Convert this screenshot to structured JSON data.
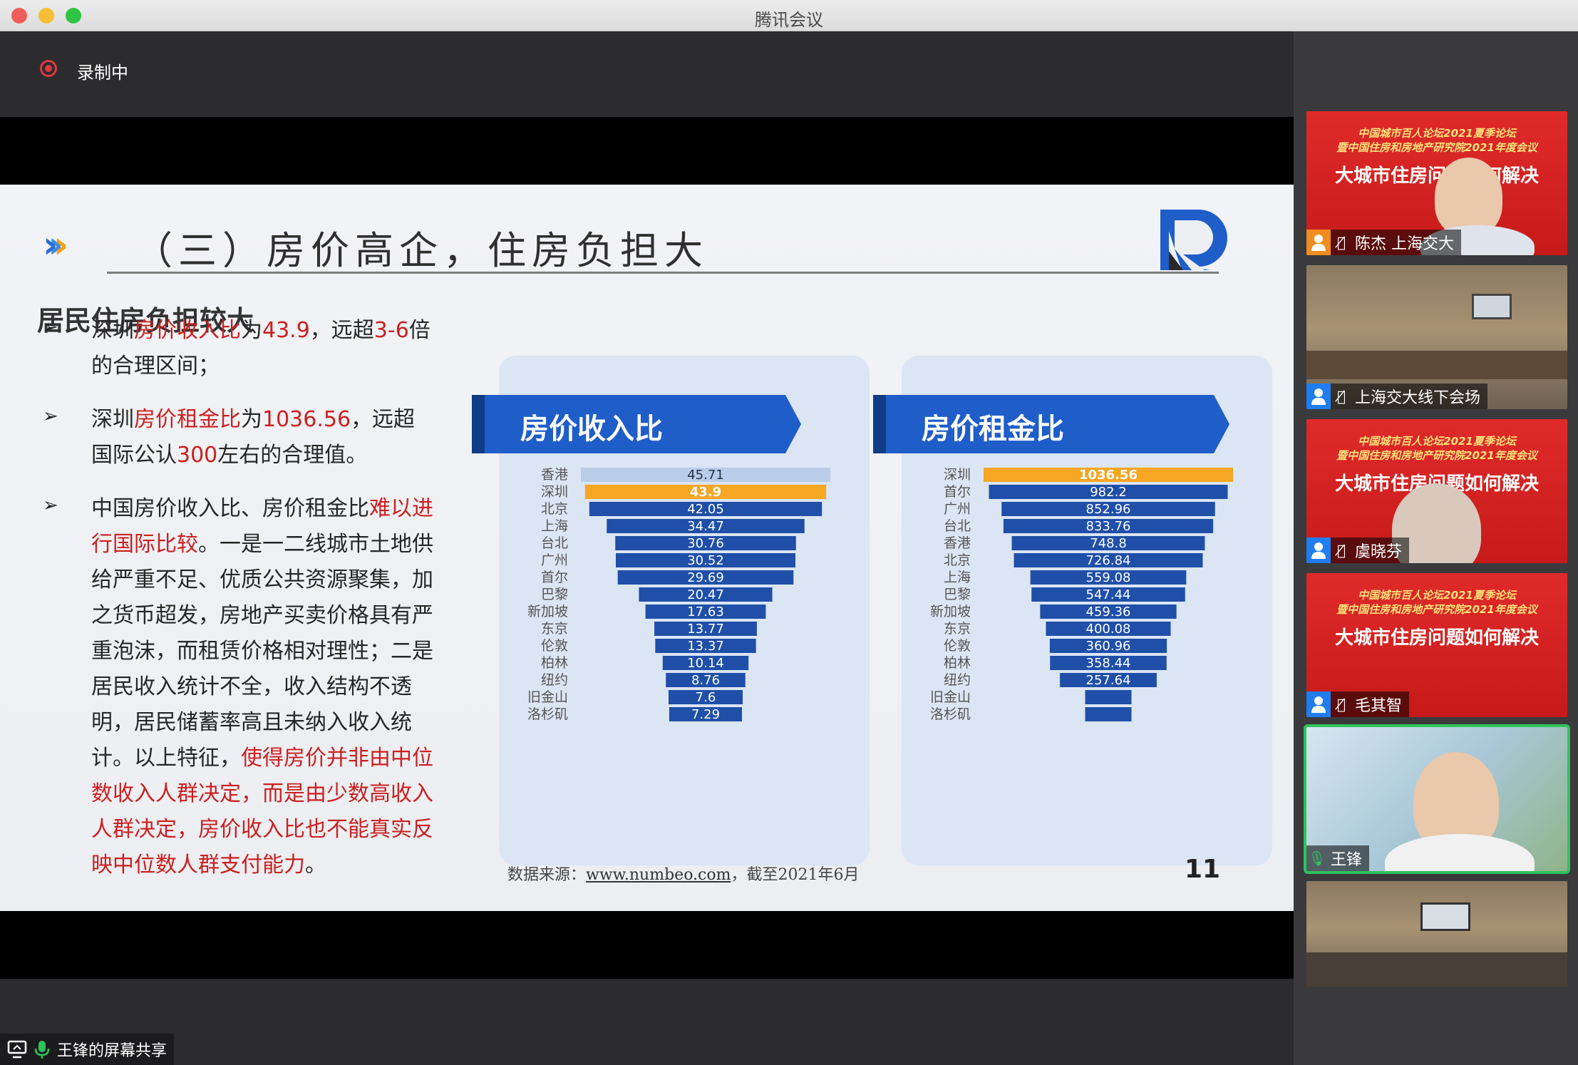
{
  "window": {
    "title": "腾讯会议",
    "controls": [
      "#ee5e58",
      "#f6be34",
      "#2fc343"
    ]
  },
  "recording": {
    "label": "录制中",
    "color": "#e0393e"
  },
  "slide": {
    "title": "（三）房价高企，住房负担大",
    "subheading": "居民住房负担较大",
    "bullets": [
      [
        {
          "t": "深圳",
          "red": false
        },
        {
          "t": "房价收入比",
          "red": true
        },
        {
          "t": "为",
          "red": false
        },
        {
          "t": "43.9",
          "red": true
        },
        {
          "t": "，远超",
          "red": false
        },
        {
          "t": "3-6",
          "red": true
        },
        {
          "t": "倍的合理区间；",
          "red": false
        }
      ],
      [
        {
          "t": "深圳",
          "red": false
        },
        {
          "t": "房价租金比",
          "red": true
        },
        {
          "t": "为",
          "red": false
        },
        {
          "t": "1036.56",
          "red": true
        },
        {
          "t": "，远超国际公认",
          "red": false
        },
        {
          "t": "300",
          "red": true
        },
        {
          "t": "左右的合理值。",
          "red": false
        }
      ],
      [
        {
          "t": "中国房价收入比、房价租金比",
          "red": false
        },
        {
          "t": "难以进行国际比较",
          "red": true
        },
        {
          "t": "。一是一二线城市土地供给严重不足、优质公共资源聚集，加之货币超发，房地产买卖价格具有严重泡沫，而租赁价格相对理性；二是居民收入统计不全，收入结构不透明，居民储蓄率高且未纳入收入统计。以上特征，",
          "red": false
        },
        {
          "t": "使得房价并非由中位数收入人群决定，而是由少数高收入人群决定，房价收入比也不能真实反映中位数人群支付能力",
          "red": true
        },
        {
          "t": "。",
          "red": false
        }
      ]
    ],
    "source_prefix": "数据来源：",
    "source_link": "www.numbeo.com",
    "source_suffix": "，截至2021年6月",
    "page_number": "11"
  },
  "chart_data": [
    {
      "type": "bar",
      "title": "房价收入比",
      "categories": [
        "香港",
        "深圳",
        "北京",
        "上海",
        "台北",
        "广州",
        "首尔",
        "巴黎",
        "新加坡",
        "东京",
        "伦敦",
        "柏林",
        "纽约",
        "旧金山",
        "洛杉矶"
      ],
      "values": [
        45.71,
        43.9,
        42.05,
        34.47,
        30.76,
        30.52,
        29.69,
        20.47,
        17.63,
        13.77,
        13.37,
        10.14,
        8.76,
        7.6,
        7.29
      ],
      "value_labels": [
        "45.71",
        "43.9",
        "42.05",
        "34.47",
        "30.76",
        "30.52",
        "29.69",
        "20.47",
        "17.63",
        "13.77",
        "13.37",
        "10.14",
        "8.76",
        "7.6",
        "7.29"
      ],
      "highlight": "深圳",
      "colors": {
        "bar": "#1f4fa8",
        "highlight": "#f5a623",
        "top": "#b9cde8"
      }
    },
    {
      "type": "bar",
      "title": "房价租金比",
      "categories": [
        "深圳",
        "首尔",
        "广州",
        "台北",
        "香港",
        "北京",
        "上海",
        "巴黎",
        "新加坡",
        "东京",
        "伦敦",
        "柏林",
        "纽约",
        "旧金山",
        "洛杉矶"
      ],
      "values": [
        1036.56,
        982.2,
        852.96,
        833.76,
        748.8,
        726.84,
        559.08,
        547.44,
        459.36,
        400.08,
        360.96,
        358.44,
        257.64,
        null,
        null
      ],
      "value_labels": [
        "1036.56",
        "982.2",
        "852.96",
        "833.76",
        "748.8",
        "726.84",
        "559.08",
        "547.44",
        "459.36",
        "400.08",
        "360.96",
        "358.44",
        "257.64",
        "",
        ""
      ],
      "highlight": "深圳",
      "colors": {
        "bar": "#1f4fa8",
        "highlight": "#f5a623"
      }
    }
  ],
  "participants": [
    {
      "name": "陈杰 上海交大",
      "type": "banner",
      "icon_color": "#f08d1e",
      "active": false
    },
    {
      "name": "上海交大线下会场",
      "type": "room",
      "icon_color": "#1f7df0",
      "active": false
    },
    {
      "name": "虞晓芬",
      "type": "banner",
      "icon_color": "#1f7df0",
      "active": false
    },
    {
      "name": "毛其智",
      "type": "banner",
      "icon_color": "#1f7df0",
      "active": false
    },
    {
      "name": "王锋",
      "type": "camera",
      "icon_color": "",
      "active": true
    },
    {
      "name": "",
      "type": "room",
      "icon_color": "",
      "active": false
    }
  ],
  "banner": {
    "line1": "中国城市百人论坛2021夏季论坛",
    "line2": "暨中国住房和房地产研究院2021年度会议",
    "big": "大城市住房问题如何解决"
  },
  "share": {
    "label": "王锋的屏幕共享"
  }
}
